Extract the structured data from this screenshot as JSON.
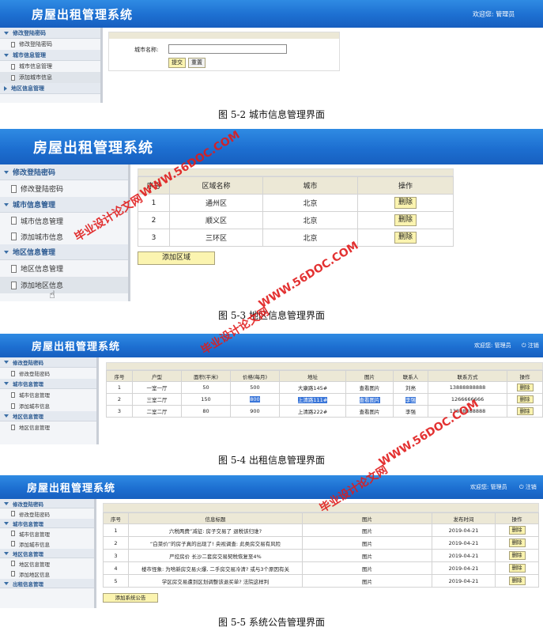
{
  "fig1": {
    "title": "房屋出租管理系统",
    "welcome": "欢迎您: 管理员",
    "side": [
      {
        "sec": "修改登陆密码",
        "items": [
          "修改登陆密码"
        ]
      },
      {
        "sec": "城市信息管理",
        "items": [
          "城市信息管理",
          "添加城市信息"
        ]
      },
      {
        "sec": "地区信息管理",
        "items": []
      }
    ],
    "form_label": "城市名称:",
    "submit": "提交",
    "reset": "重置",
    "caption": "图 5-2 城市信息管理界面"
  },
  "fig2": {
    "title": "房屋出租管理系统",
    "side": [
      {
        "sec": "修改登陆密码",
        "items": [
          "修改登陆密码"
        ]
      },
      {
        "sec": "城市信息管理",
        "items": [
          "城市信息管理",
          "添加城市信息"
        ]
      },
      {
        "sec": "地区信息管理",
        "items": [
          "地区信息管理",
          "添加地区信息"
        ]
      }
    ],
    "headers": [
      "序号",
      "区域名称",
      "城市",
      "操作"
    ],
    "rows": [
      [
        "1",
        "通州区",
        "北京",
        "删除"
      ],
      [
        "2",
        "顺义区",
        "北京",
        "删除"
      ],
      [
        "3",
        "三环区",
        "北京",
        "删除"
      ]
    ],
    "add_btn": "添加区域",
    "caption": "图 5-3 地区信息管理界面"
  },
  "fig3": {
    "title": "房屋出租管理系统",
    "welcome": "欢迎您: 管理员",
    "logout": "注销",
    "side": [
      {
        "sec": "修改登陆密码",
        "items": [
          "修改登陆密码"
        ]
      },
      {
        "sec": "城市信息管理",
        "items": [
          "城市信息管理",
          "添加城市信息"
        ]
      },
      {
        "sec": "地区信息管理",
        "items": [
          "地区信息管理"
        ]
      }
    ],
    "headers": [
      "序号",
      "户型",
      "面积(平米)",
      "价格(每月)",
      "地址",
      "图片",
      "联系人",
      "联系方式",
      "操作"
    ],
    "rows": [
      [
        "1",
        "一室一厅",
        "50",
        "500",
        "大康路145#",
        "查看图片",
        "刘亮",
        "13888888888",
        "删除"
      ],
      [
        "2",
        "三室二厅",
        "150",
        "800",
        "上清路111#",
        "查看图片",
        "李强",
        "1266666666",
        "删除"
      ],
      [
        "3",
        "二室二厅",
        "80",
        "900",
        "上清路222#",
        "查看图片",
        "李强",
        "13888888888",
        "删除"
      ]
    ],
    "caption": "图 5-4 出租信息管理界面"
  },
  "fig4": {
    "title": "房屋出租管理系统",
    "welcome": "欢迎您: 管理员",
    "logout": "注销",
    "side": [
      {
        "sec": "修改登陆密码",
        "items": [
          "修改登陆密码"
        ]
      },
      {
        "sec": "城市信息管理",
        "items": [
          "城市信息管理",
          "添加城市信息"
        ]
      },
      {
        "sec": "地区信息管理",
        "items": [
          "地区信息管理",
          "添加地区信息"
        ]
      },
      {
        "sec": "出租信息管理",
        "items": []
      }
    ],
    "headers": [
      "序号",
      "信息标题",
      "图片",
      "发布时间",
      "操作"
    ],
    "rows": [
      [
        "1",
        "六税两费”减征: 房子交易了 退税该归谁?",
        "图片",
        "2019-04-21",
        "删除"
      ],
      [
        "2",
        "“白菜价”的房子真的出现了! 央视调查: 此类房交易有风险",
        "图片",
        "2019-04-21",
        "删除"
      ],
      [
        "3",
        "严控房价 长沙二套房交易契税恢复至4%",
        "图片",
        "2019-04-21",
        "删除"
      ],
      [
        "4",
        "楼市怪象: 为啥新房交易火爆, 二手房交易冷清? 或与3个原因有关",
        "图片",
        "2019-04-21",
        "删除"
      ],
      [
        "5",
        "学区房交易遭到区划调整该退买单? 法院这样判",
        "图片",
        "2019-04-21",
        "删除"
      ]
    ],
    "add_btn": "添加系统公告",
    "caption": "图 5-5 系统公告管理界面"
  },
  "watermarks": {
    "url": "WWW.56DOC.COM",
    "cn": "毕业设计论文网"
  }
}
